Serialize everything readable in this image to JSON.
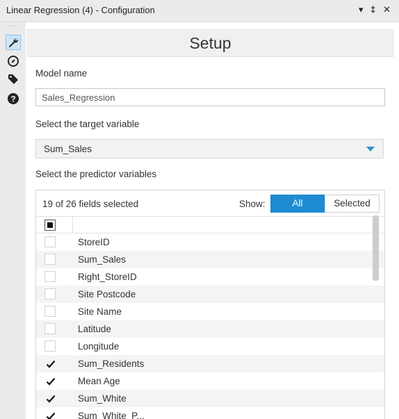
{
  "window": {
    "title": "Linear Regression (4) - Configuration",
    "controls": [
      "▾",
      "‡",
      "✕"
    ]
  },
  "sidebar": {
    "items": [
      {
        "icon": "wrench-icon",
        "active": true
      },
      {
        "icon": "compass-icon",
        "active": false
      },
      {
        "icon": "tag-icon",
        "active": false
      },
      {
        "icon": "help-icon",
        "active": false
      }
    ]
  },
  "setup": {
    "header": "Setup",
    "model_name_label": "Model name",
    "model_name_value": "Sales_Regression",
    "target_label": "Select the target variable",
    "target_value": "Sum_Sales",
    "predictor_label": "Select the predictor variables"
  },
  "fields": {
    "count_text": "19 of 26 fields selected",
    "show_label": "Show:",
    "filter_all": "All",
    "filter_selected": "Selected",
    "rows": [
      {
        "name": "StoreID",
        "checked": false
      },
      {
        "name": "Sum_Sales",
        "checked": false
      },
      {
        "name": "Right_StoreID",
        "checked": false
      },
      {
        "name": "Site Postcode",
        "checked": false
      },
      {
        "name": "Site Name",
        "checked": false
      },
      {
        "name": "Latitude",
        "checked": false
      },
      {
        "name": "Longitude",
        "checked": false
      },
      {
        "name": "Sum_Residents",
        "checked": true
      },
      {
        "name": "Mean Age",
        "checked": true
      },
      {
        "name": "Sum_White",
        "checked": true
      },
      {
        "name": "Sum_White_P...",
        "checked": true
      }
    ]
  },
  "colors": {
    "accent": "#1f8bd2",
    "dropdown_arrow": "#2a8fc9"
  }
}
